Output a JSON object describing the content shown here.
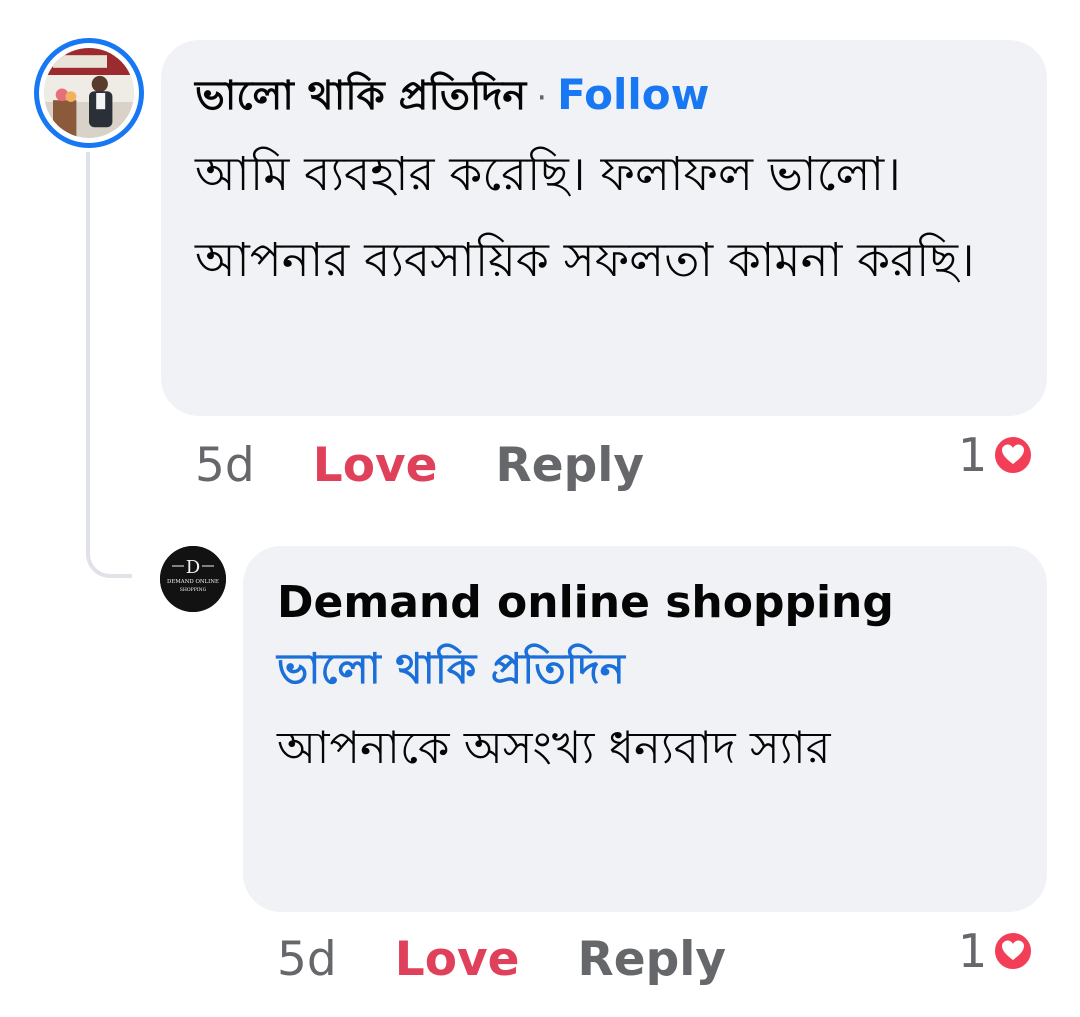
{
  "comment": {
    "author": "ভালো থাকি প্রতিদিন",
    "separator": "·",
    "follow_label": "Follow",
    "text": "আমি ব্যবহার করেছি। ফলাফল ভালো। আপনার ব্যবসায়িক সফলতা কামনা করছি।",
    "actions": {
      "time": "5d",
      "love_label": "Love",
      "reply_label": "Reply"
    },
    "reaction_count": "1",
    "reaction_icon": "heart-icon"
  },
  "reply": {
    "author": "Demand online shopping",
    "mention": "ভালো থাকি প্রতিদিন",
    "text": "আপনাকে অসংখ্য ধন্যবাদ স্যার",
    "actions": {
      "time": "5d",
      "love_label": "Love",
      "reply_label": "Reply"
    },
    "reaction_count": "1",
    "reaction_icon": "heart-icon"
  },
  "colors": {
    "accent": "#1877f2",
    "love": "#e0415a",
    "bubble": "#f0f2f5",
    "muted": "#65676b"
  }
}
